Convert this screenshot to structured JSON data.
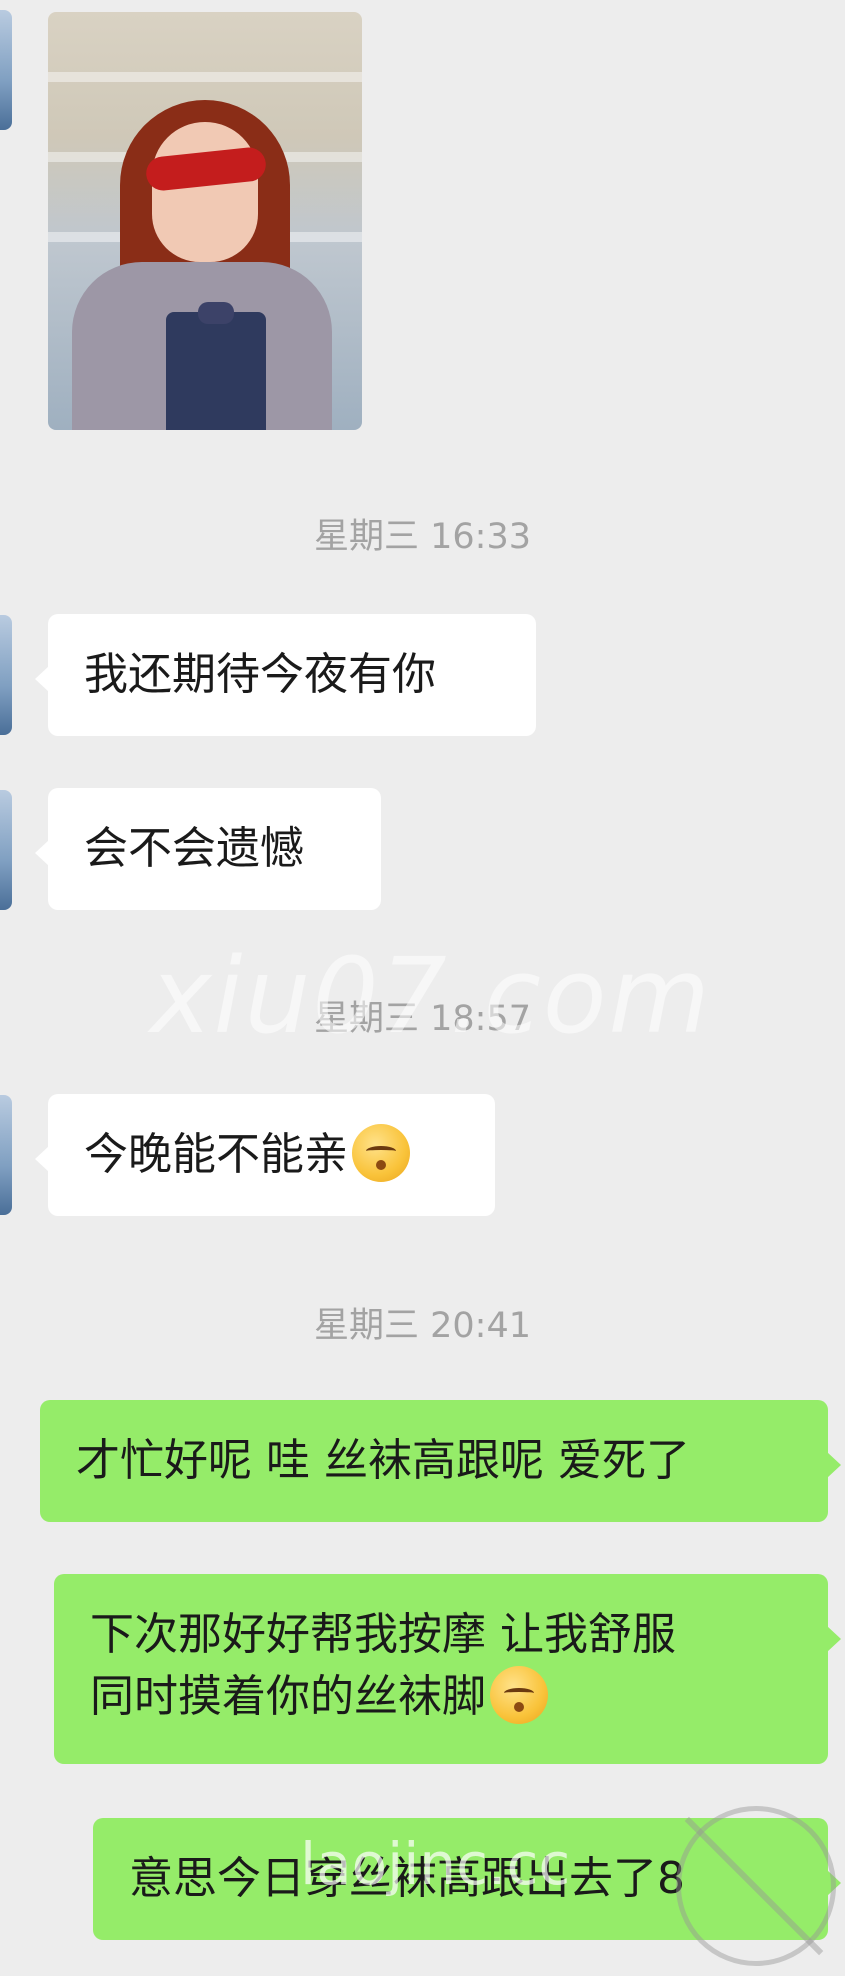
{
  "chat": {
    "time_1": "星期三 16:33",
    "msg_1": "我还期待今夜有你",
    "msg_2": "会不会遗憾",
    "time_2": "星期三 18:57",
    "msg_3": "今晚能不能亲",
    "msg_3_emoji": "kissing-face-emoji",
    "time_3": "星期三 20:41",
    "msg_4": "才忙好呢 哇 丝袜高跟呢 爱死了",
    "msg_5_line_1": "下次那好好帮我按摩 让我舒服",
    "msg_5_line_2": "同时摸着你的丝袜脚",
    "msg_5_emoji": "hand-over-mouth-emoji",
    "msg_6": "意思今日穿丝袜高跟出去了8"
  },
  "watermarks": {
    "wm_1": "xiu07.com",
    "wm_2": "laojinc.cc"
  },
  "colors": {
    "background": "#ededed",
    "incoming_bubble": "#ffffff",
    "outgoing_bubble": "#95ec69",
    "timestamp": "#a3a3a3"
  }
}
